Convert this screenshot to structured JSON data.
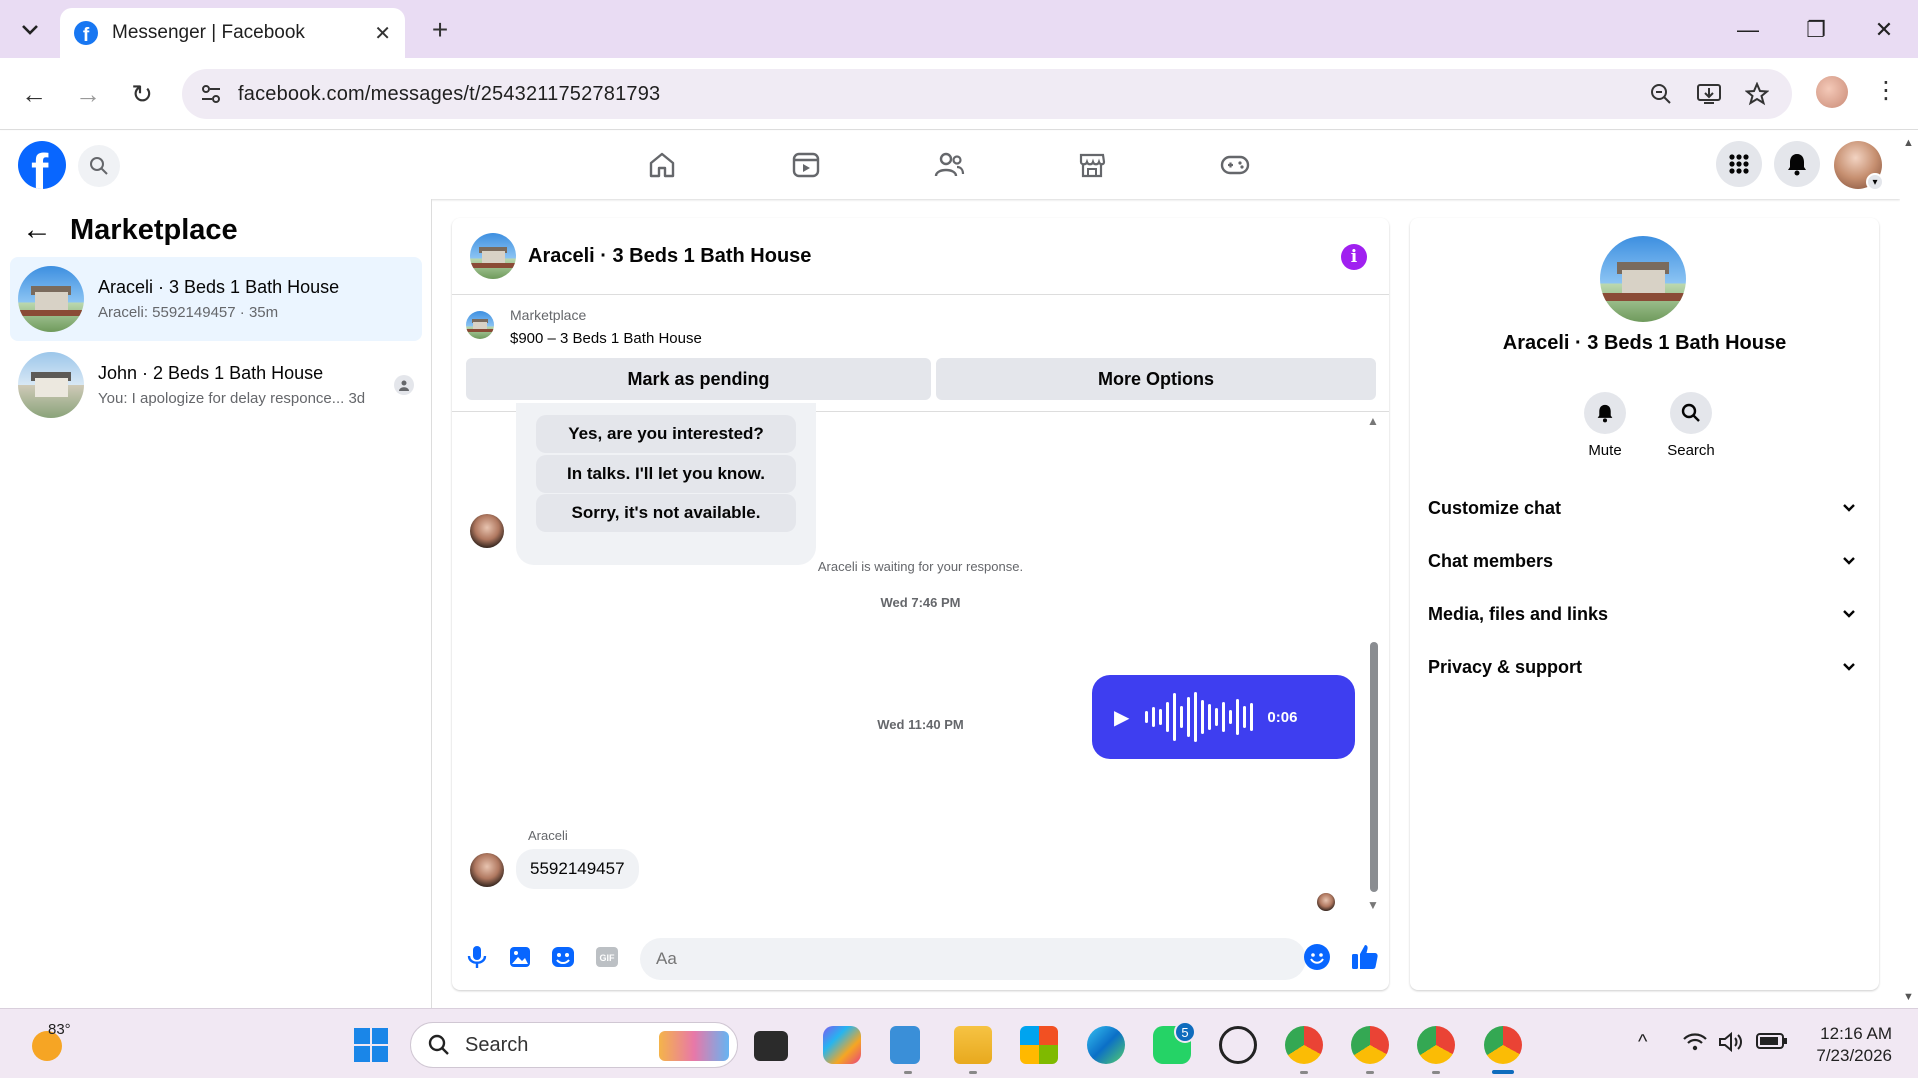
{
  "browser": {
    "tab_title": "Messenger | Facebook",
    "url": "facebook.com/messages/t/2543211752781793",
    "close_glyph": "✕",
    "new_tab_glyph": "+",
    "minimize_glyph": "—",
    "restore_glyph": "❐",
    "window_close_glyph": "✕",
    "back_glyph": "←",
    "forward_glyph": "→",
    "reload_glyph": "↻",
    "menu_glyph": "⋮"
  },
  "fb": {
    "logo_letter": "f",
    "nav_icons": [
      "home-icon",
      "video-icon",
      "groups-icon",
      "marketplace-icon",
      "gaming-icon"
    ],
    "right_icons": [
      "menu-grid-icon",
      "notifications-icon"
    ],
    "brand_color": "#0866ff"
  },
  "sidebar": {
    "back_glyph": "←",
    "title": "Marketplace",
    "conversations": [
      {
        "name": "Araceli · 3 Beds 1 Bath House",
        "preview": "Araceli: 5592149457 · 35m",
        "active": true
      },
      {
        "name": "John · 2 Beds 1 Bath House",
        "preview": "You: I apologize for delay responce...  3d",
        "active": false
      }
    ]
  },
  "chat": {
    "title": "Araceli · 3 Beds 1 Bath House",
    "info_glyph": "i",
    "marketplace_label": "Marketplace",
    "listing": "$900 – 3 Beds 1 Bath House",
    "mark_pending": "Mark as pending",
    "more_options": "More Options",
    "quick_replies": [
      "Yes, are you interested?",
      "In talks. I'll let you know.",
      "Sorry, it's not available."
    ],
    "waiting_notice": "Araceli is waiting for your response.",
    "timestamp_1": "Wed 7:46 PM",
    "voice_duration": "0:06",
    "play_glyph": "▶",
    "timestamp_2": "Wed 11:40 PM",
    "sender_name": "Araceli",
    "last_message": "5592149457",
    "input_placeholder": "Aa",
    "accent_color": "#3e3ef0"
  },
  "details": {
    "name": "Araceli · 3 Beds 1 Bath House",
    "mute_label": "Mute",
    "search_label": "Search",
    "sections": [
      "Customize chat",
      "Chat members",
      "Media, files and links",
      "Privacy & support"
    ],
    "chevron_glyph": "⌄"
  },
  "taskbar": {
    "temperature": "83°",
    "search_label": "Search",
    "whatsapp_badge": "5",
    "time": "12:16 AM",
    "date": "7/23/2026",
    "tray_up_glyph": "^"
  }
}
